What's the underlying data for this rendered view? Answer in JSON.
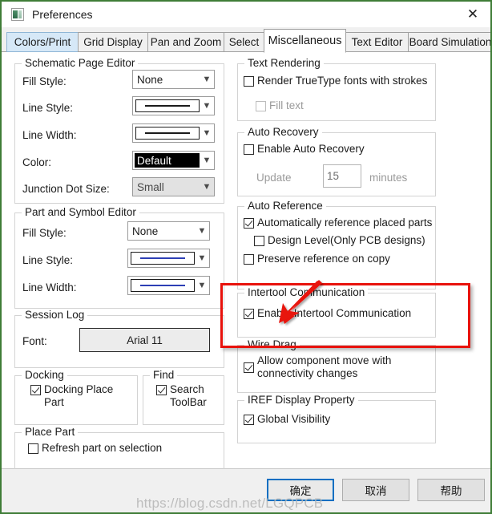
{
  "window": {
    "title": "Preferences",
    "icon": "app-icon",
    "close_label": "✕",
    "border_color": "#3f7d37"
  },
  "tabs": [
    {
      "label": "Colors/Print",
      "state": "hover"
    },
    {
      "label": "Grid Display",
      "state": "normal"
    },
    {
      "label": "Pan and Zoom",
      "state": "normal"
    },
    {
      "label": "Select",
      "state": "normal"
    },
    {
      "label": "Miscellaneous",
      "state": "active"
    },
    {
      "label": "Text Editor",
      "state": "normal"
    },
    {
      "label": "Board Simulation",
      "state": "normal"
    }
  ],
  "schematic_page_editor": {
    "legend": "Schematic Page Editor",
    "fill_style_label": "Fill Style:",
    "fill_style_value": "None",
    "line_style_label": "Line Style:",
    "line_width_label": "Line Width:",
    "color_label": "Color:",
    "color_value": "Default",
    "junction_dot_size_label": "Junction Dot Size:",
    "junction_dot_size_value": "Small"
  },
  "part_and_symbol_editor": {
    "legend": "Part and Symbol Editor",
    "fill_style_label": "Fill Style:",
    "fill_style_value": "None",
    "line_style_label": "Line Style:",
    "line_width_label": "Line Width:"
  },
  "session_log": {
    "legend": "Session Log",
    "font_label": "Font:",
    "font_value": "Arial 11"
  },
  "docking": {
    "legend": "Docking",
    "docking_place_part": "Docking Place Part",
    "docking_place_part_checked": true
  },
  "find": {
    "legend": "Find",
    "search_toolbar": "Search ToolBar",
    "search_toolbar_checked": true
  },
  "place_part": {
    "legend": "Place Part",
    "refresh_part": "Refresh part on selection",
    "refresh_part_checked": false
  },
  "text_rendering": {
    "legend": "Text Rendering",
    "render_truetype": "Render TrueType fonts with strokes",
    "render_truetype_checked": false,
    "fill_text": "Fill text",
    "fill_text_checked": false,
    "fill_text_enabled": false
  },
  "auto_recovery": {
    "legend": "Auto Recovery",
    "enable_label": "Enable Auto Recovery",
    "enable_checked": false,
    "update_label": "Update",
    "minutes_value": "15",
    "minutes_label": "minutes",
    "enabled": false
  },
  "auto_reference": {
    "legend": "Auto Reference",
    "auto_ref_label": "Automatically reference placed parts",
    "auto_ref_checked": true,
    "design_level_label": "Design Level(Only PCB designs)",
    "design_level_checked": false,
    "preserve_label": "Preserve reference on copy",
    "preserve_checked": false
  },
  "intertool": {
    "legend": "Intertool Communication",
    "enable_label": "Enable Intertool Communication",
    "enable_checked": true
  },
  "wire_drag": {
    "legend": "Wire Drag",
    "allow_label": "Allow component move with connectivity changes",
    "allow_checked": true
  },
  "iref": {
    "legend": "IREF Display Property",
    "global_visibility_label": "Global Visibility",
    "global_visibility_checked": true
  },
  "footer": {
    "ok_label": "确定",
    "cancel_label": "取消",
    "help_label": "帮助",
    "default_button": "ok"
  },
  "annotation": {
    "highlight_color": "#e8120c",
    "arrow_target": "Intertool Communication"
  },
  "watermark": {
    "text": "https://blog.csdn.net/LGQPCB"
  }
}
